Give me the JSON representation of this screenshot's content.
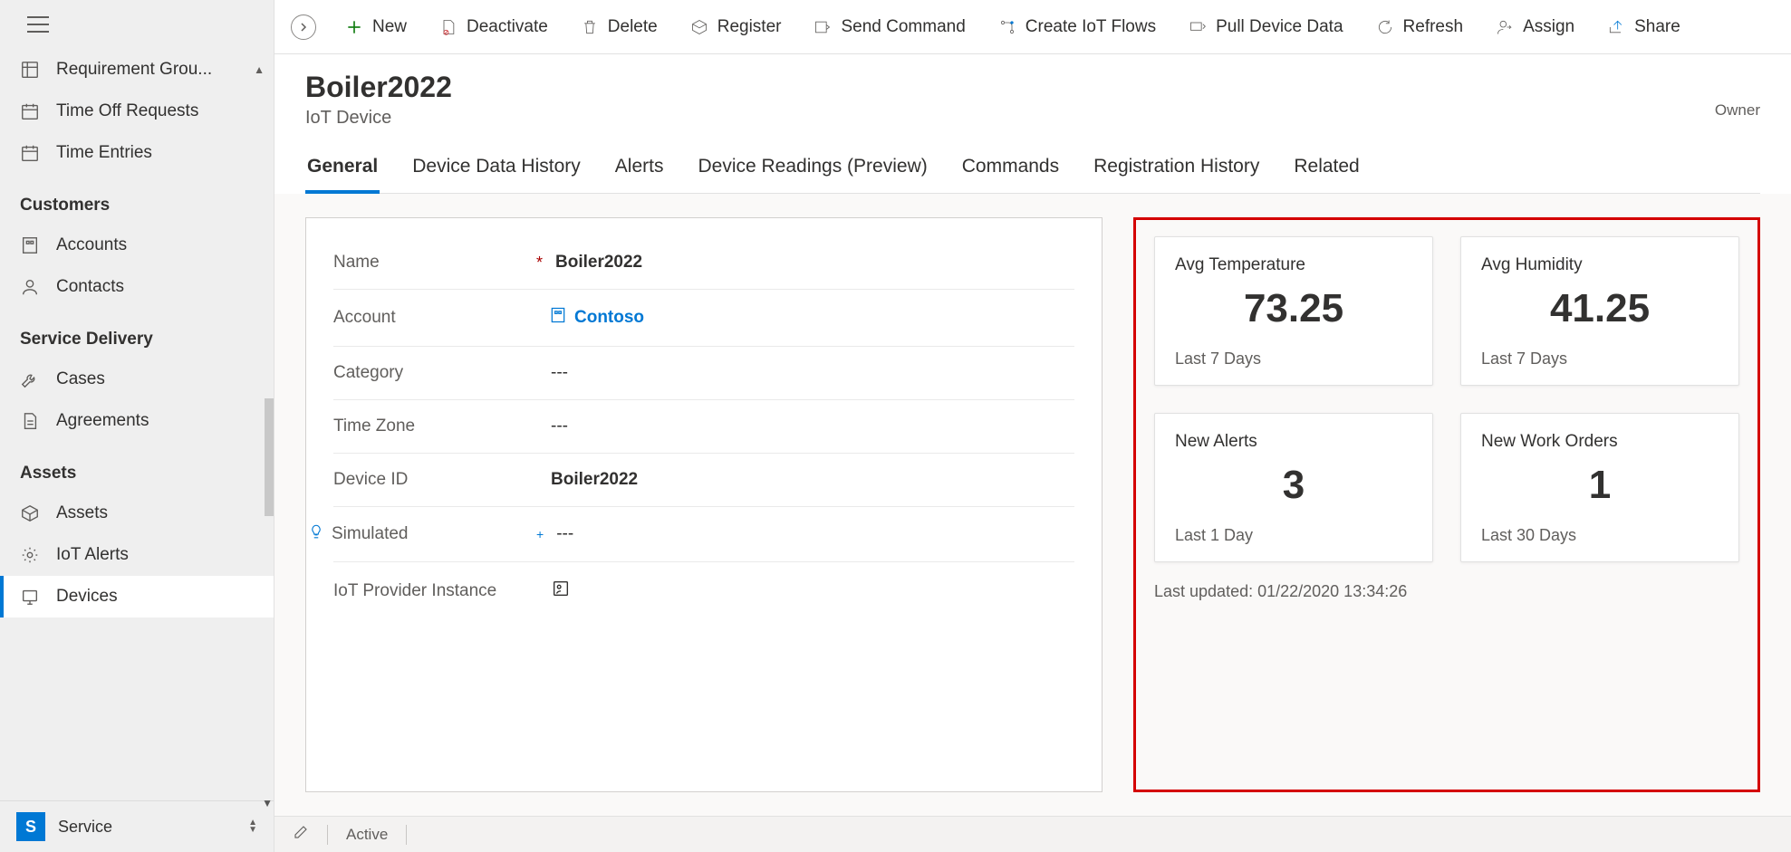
{
  "sidebar": {
    "top_items": [
      {
        "label": "Requirement Grou..."
      },
      {
        "label": "Time Off Requests"
      },
      {
        "label": "Time Entries"
      }
    ],
    "sections": [
      {
        "heading": "Customers",
        "items": [
          {
            "label": "Accounts"
          },
          {
            "label": "Contacts"
          }
        ]
      },
      {
        "heading": "Service Delivery",
        "items": [
          {
            "label": "Cases"
          },
          {
            "label": "Agreements"
          }
        ]
      },
      {
        "heading": "Assets",
        "items": [
          {
            "label": "Assets"
          },
          {
            "label": "IoT Alerts"
          },
          {
            "label": "Devices"
          }
        ]
      }
    ],
    "footer_badge": "S",
    "footer_label": "Service"
  },
  "commands": {
    "new": "New",
    "deactivate": "Deactivate",
    "delete": "Delete",
    "register": "Register",
    "send_command": "Send Command",
    "create_flows": "Create IoT Flows",
    "pull_data": "Pull Device Data",
    "refresh": "Refresh",
    "assign": "Assign",
    "share": "Share"
  },
  "header": {
    "title": "Boiler2022",
    "subtitle": "IoT Device",
    "owner_label": "Owner"
  },
  "tabs": [
    "General",
    "Device Data History",
    "Alerts",
    "Device Readings (Preview)",
    "Commands",
    "Registration History",
    "Related"
  ],
  "form": {
    "name_label": "Name",
    "name_value": "Boiler2022",
    "account_label": "Account",
    "account_value": "Contoso",
    "category_label": "Category",
    "category_value": "---",
    "timezone_label": "Time Zone",
    "timezone_value": "---",
    "deviceid_label": "Device ID",
    "deviceid_value": "Boiler2022",
    "simulated_label": "Simulated",
    "simulated_value": "---",
    "provider_label": "IoT Provider Instance"
  },
  "cards": [
    {
      "title": "Avg Temperature",
      "value": "73.25",
      "period": "Last 7 Days"
    },
    {
      "title": "Avg Humidity",
      "value": "41.25",
      "period": "Last 7 Days"
    },
    {
      "title": "New Alerts",
      "value": "3",
      "period": "Last 1 Day"
    },
    {
      "title": "New Work Orders",
      "value": "1",
      "period": "Last 30 Days"
    }
  ],
  "last_updated": "Last updated: 01/22/2020 13:34:26",
  "status": {
    "active": "Active"
  }
}
